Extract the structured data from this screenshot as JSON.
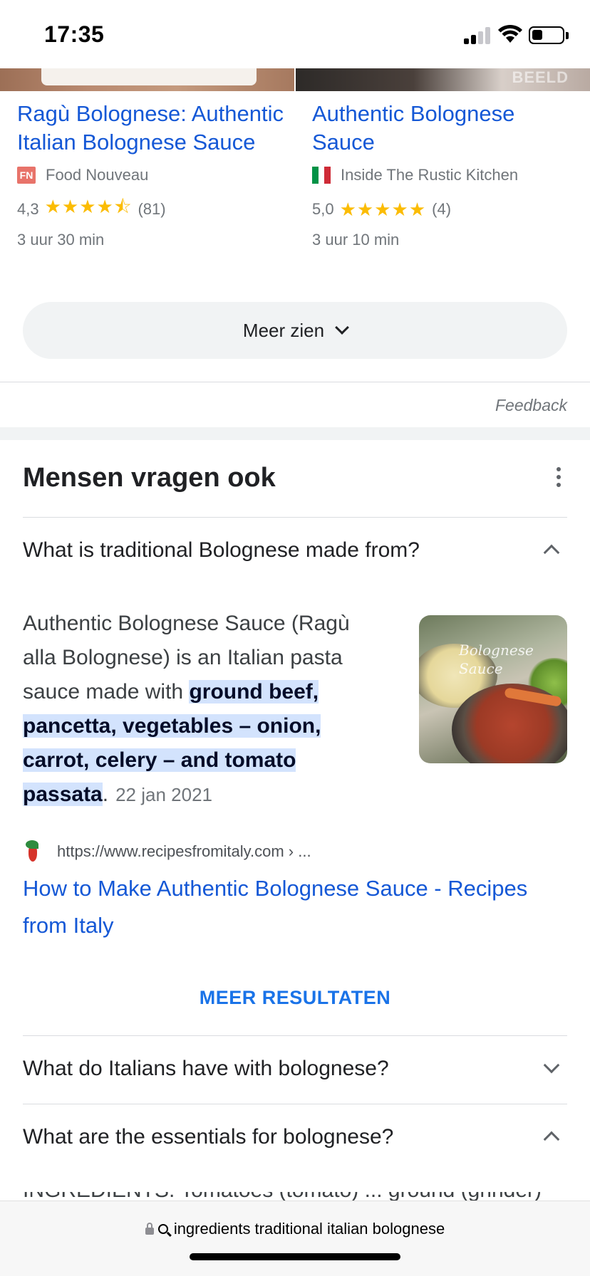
{
  "status_bar": {
    "time": "17:35"
  },
  "recipes": [
    {
      "title": "Ragù Bolognese: Authentic Italian Bolognese Sauce",
      "source": "Food Nouveau",
      "source_logo": "FN",
      "rating": "4,3",
      "stars_value": 4.3,
      "stars": "★★★★⯪",
      "reviews": "(81)",
      "time": "3 uur 30 min"
    },
    {
      "title": "Authentic Bolognese Sauce",
      "source": "Inside The Rustic Kitchen",
      "rating": "5,0",
      "stars_value": 5.0,
      "stars": "★★★★★",
      "reviews": "(4)",
      "time": "3 uur 10 min"
    }
  ],
  "more_button": {
    "label": "Meer zien"
  },
  "feedback_label": "Feedback",
  "people_also_ask": {
    "title": "Mensen vragen ook",
    "questions": [
      {
        "text": "What is traditional Bolognese made from?",
        "expanded": true
      },
      {
        "text": "What do Italians have with bolognese?",
        "expanded": false
      },
      {
        "text": "What are the essentials for bolognese?",
        "expanded": true
      }
    ],
    "answer": {
      "text_before": "Authentic Bolognese Sauce (Ragù alla Bolognese) is an Italian pasta sauce made with ",
      "highlight": "ground beef, pancetta, vegetables – onion, carrot, celery – and tomato passata",
      "text_after": ".",
      "date": "22 jan 2021",
      "image_caption": "Bolognese Sauce",
      "site_url": "https://www.recipesfromitaly.com › ...",
      "link_title": "How to Make Authentic Bolognese Sauce - Recipes from Italy"
    },
    "more_results_label": "MEER RESULTATEN",
    "partial_next_text": "INGREDIENTS. Tomatoes (tomato) ... ground (grinder)"
  },
  "address_bar": {
    "query": "ingredients traditional italian bolognese"
  },
  "colors": {
    "link": "#1558d6",
    "highlight_bg": "#d3e3fd",
    "star": "#fbbc04",
    "more_results": "#1a73e8"
  }
}
